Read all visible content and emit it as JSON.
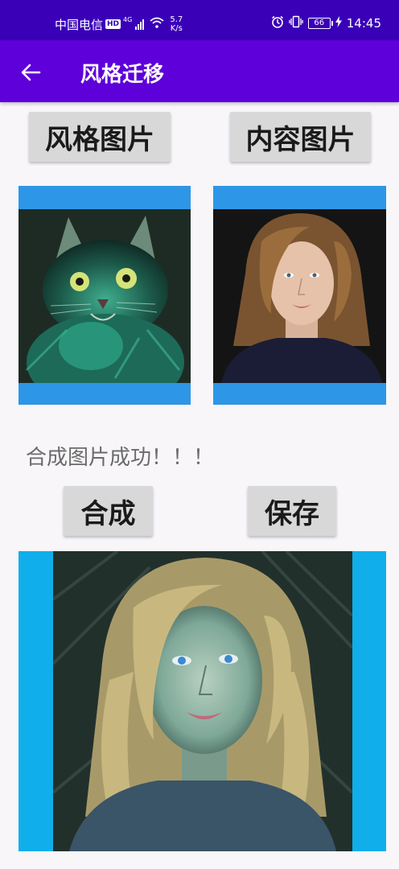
{
  "status_bar": {
    "carrier": "中国电信",
    "hd": "HD",
    "network": "4G",
    "speed_top": "5.7",
    "speed_bottom": "K/s",
    "battery": "66",
    "time": "14:45"
  },
  "app_bar": {
    "title": "风格迁移"
  },
  "buttons": {
    "style_image": "风格图片",
    "content_image": "内容图片",
    "synthesize": "合成",
    "save": "保存"
  },
  "status_message": "合成图片成功！！！",
  "colors": {
    "status_bar": "#3a00b8",
    "app_bar": "#5e00d9",
    "frame_blue": "#2e96e6",
    "result_blue": "#10aeea",
    "button_gray": "#d9d8d9"
  },
  "icons": {
    "back": "arrow-left-icon"
  }
}
